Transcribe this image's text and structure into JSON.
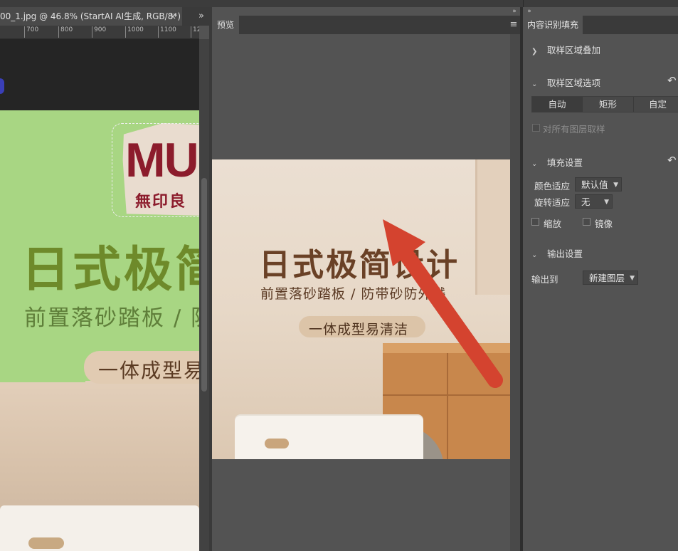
{
  "document": {
    "tab_title": "00_1.jpg @ 46.8% (StartAI AI生成, RGB/8*) *",
    "close_glyph": "×",
    "more_glyph": "»",
    "ruler_ticks": [
      "700",
      "800",
      "900",
      "1000",
      "1100",
      "12"
    ]
  },
  "canvas": {
    "logo_text": "MU",
    "logo_sub": "無印良",
    "headline": "日式极简",
    "subline": "前置落砂踏板 / 防",
    "pill_text": "一体成型易"
  },
  "preview_panel": {
    "tab_label": "预览",
    "collapse_glyph": "»",
    "menu_glyph": "≡",
    "image": {
      "headline": "日式极简设计",
      "subline": "前置落砂踏板 / 防带砂防外溅",
      "pill_text": "一体成型易清洁"
    },
    "annotation": {
      "type": "arrow",
      "color": "#d4432f"
    }
  },
  "right_panel": {
    "tab_label": "内容识别填充",
    "collapse_glyph": "»",
    "sections": {
      "sampling_overlay": {
        "label": "取样区域叠加",
        "expanded": false
      },
      "sampling_options": {
        "label": "取样区域选项",
        "expanded": true
      },
      "fill_settings": {
        "label": "填充设置",
        "expanded": true
      },
      "output_settings": {
        "label": "输出设置",
        "expanded": true
      }
    },
    "sampling_modes": [
      "自动",
      "矩形",
      "自定"
    ],
    "sampling_mode_selected": "自动",
    "sample_all_layers": {
      "label": "对所有图层取样",
      "checked": false,
      "enabled": false
    },
    "color_adaptation": {
      "label": "颜色适应",
      "value": "默认值"
    },
    "rotation_adaptation": {
      "label": "旋转适应",
      "value": "无"
    },
    "scale": {
      "label": "缩放",
      "checked": false
    },
    "mirror": {
      "label": "镜像",
      "checked": false
    },
    "output_to": {
      "label": "输出到",
      "value": "新建图层"
    },
    "reset_glyph": "↶"
  },
  "colors": {
    "panel_bg": "#535353",
    "tab_bar": "#3a3a3a",
    "canvas_green": "#a8d683",
    "annotation_red": "#d4432f",
    "headline_brown": "#6a4126"
  }
}
